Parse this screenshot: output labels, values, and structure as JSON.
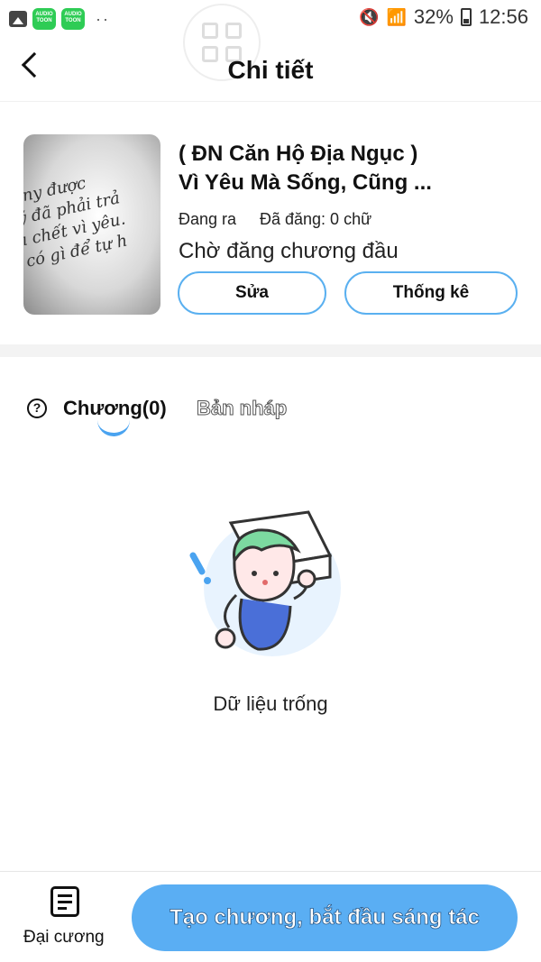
{
  "status_bar": {
    "app_badge_1": "AUDIO TOON",
    "app_badge_2": "AUDIO TOON",
    "dots": "··",
    "battery": "32%",
    "time": "12:56"
  },
  "header": {
    "title": "Chi tiết"
  },
  "book": {
    "title_line1": "( ĐN Căn Hộ Địa Ngục )",
    "title_line2": "Vì Yêu Mà Sống, Cũng ...",
    "cover_text": [
      "ony được",
      "ỹ đã phải trả",
      "ı chết vì yêu.",
      "có gì để tự h"
    ],
    "status": "Đang ra",
    "words": "Đã đăng: 0 chữ",
    "waiting": "Chờ đăng chương đầu",
    "edit_label": "Sửa",
    "stats_label": "Thống kê"
  },
  "tabs": {
    "help_glyph": "?",
    "chapter_label": "Chương(0)",
    "draft_label": "Bản nháp"
  },
  "empty": {
    "text": "Dữ liệu trống"
  },
  "bottom": {
    "outline_label": "Đại cương",
    "create_label": "Tạo chương, bắt đầu sáng tác"
  }
}
